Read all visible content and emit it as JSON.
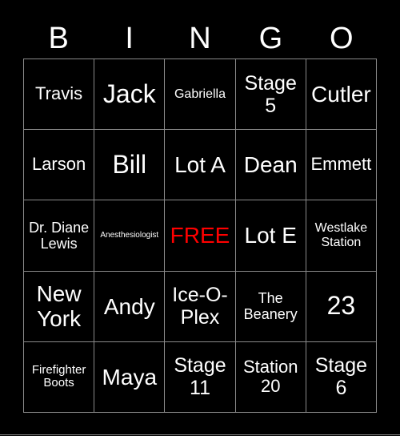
{
  "header": {
    "letters": [
      "B",
      "I",
      "N",
      "G",
      "O"
    ]
  },
  "board": {
    "free_color": "#ff0000",
    "rows": [
      [
        "Travis",
        "Jack",
        "Gabriella",
        "Stage 5",
        "Cutler"
      ],
      [
        "Larson",
        "Bill",
        "Lot A",
        "Dean",
        "Emmett"
      ],
      [
        "Dr. Diane Lewis",
        "Anesthesiologist",
        "FREE",
        "Lot E",
        "Westlake Station"
      ],
      [
        "New York",
        "Andy",
        "Ice-O-Plex",
        "The Beanery",
        "23"
      ],
      [
        "Firefighter Boots",
        "Maya",
        "Stage 11",
        "Station 20",
        "Stage 6"
      ]
    ]
  }
}
